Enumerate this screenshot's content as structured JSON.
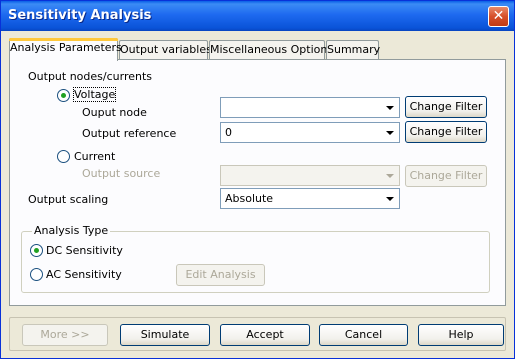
{
  "window": {
    "title": "Sensitivity Analysis"
  },
  "tabs": [
    {
      "label": "Analysis Parameters",
      "active": true
    },
    {
      "label": "Output variables",
      "active": false
    },
    {
      "label": "Miscellaneous Options",
      "active": false
    },
    {
      "label": "Summary",
      "active": false
    }
  ],
  "output": {
    "section_label": "Output nodes/currents",
    "voltage_label": "Voltage",
    "output_node_label": "Ouput node",
    "output_node_value": "",
    "output_reference_label": "Output reference",
    "output_reference_value": "0",
    "current_label": "Current",
    "output_source_label": "Output source",
    "output_source_value": "",
    "change_filter_label": "Change Filter",
    "scaling_label": "Output scaling",
    "scaling_value": "Absolute",
    "selected": "Voltage"
  },
  "analysis_type": {
    "title": "Analysis Type",
    "dc_label": "DC Sensitivity",
    "ac_label": "AC Sensitivity",
    "edit_label": "Edit Analysis",
    "selected": "DC Sensitivity"
  },
  "buttons": {
    "more": "More >>",
    "simulate": "Simulate",
    "accept": "Accept",
    "cancel": "Cancel",
    "help": "Help"
  },
  "colors": {
    "title_bar": "#0a53d8",
    "face": "#ece9d8",
    "panel": "#fcfcfe",
    "radio_dot": "#21a121"
  }
}
